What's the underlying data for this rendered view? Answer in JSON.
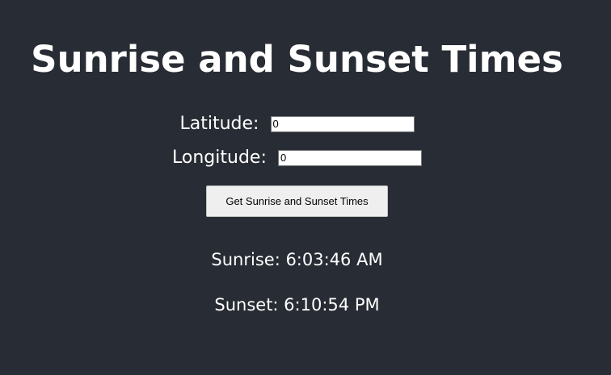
{
  "app": {
    "title": "Sunrise and Sunset Times"
  },
  "form": {
    "latitude": {
      "label": "Latitude:",
      "value": "0"
    },
    "longitude": {
      "label": "Longitude:",
      "value": "0"
    },
    "submit_label": "Get Sunrise and Sunset Times"
  },
  "results": {
    "sunrise": "Sunrise: 6:03:46 AM",
    "sunset": "Sunset: 6:10:54 PM"
  },
  "colors": {
    "background": "#282c34",
    "text": "#ffffff",
    "button_bg": "#efefef"
  }
}
